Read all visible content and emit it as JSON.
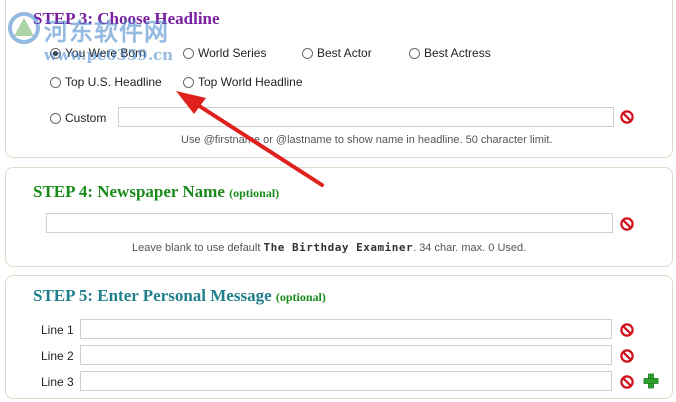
{
  "step3": {
    "title": "STEP 3: Choose Headline",
    "options": [
      "You Were Born",
      "World Series",
      "Best Actor",
      "Best Actress",
      "Top U.S. Headline",
      "Top World Headline",
      "Custom"
    ],
    "selected": "You Were Born",
    "custom_value": "",
    "hint": "Use @firstname or @lastname to show name in headline. 50 character limit."
  },
  "step4": {
    "title": "STEP 4: Newspaper Name",
    "optional": "(optional)",
    "value": "",
    "hint_prefix": "Leave blank to use default",
    "hint_default": "The Birthday Examiner",
    "hint_suffix": ". 34 char. max. 0 Used."
  },
  "step5": {
    "title": "STEP 5: Enter Personal Message",
    "optional": "(optional)",
    "lines": [
      {
        "label": "Line 1",
        "value": ""
      },
      {
        "label": "Line 2",
        "value": ""
      },
      {
        "label": "Line 3",
        "value": ""
      }
    ]
  },
  "watermark": {
    "line1": "河东软件网",
    "line2": "www.pc0359.cn"
  },
  "colors": {
    "step3_title": "#7a1fa0",
    "step4_title": "#1a8a1a",
    "step5_title": "#1f7f8a",
    "clear_icon": "#d0111a",
    "add_icon": "#2ea02e",
    "arrow": "#e0201c"
  }
}
